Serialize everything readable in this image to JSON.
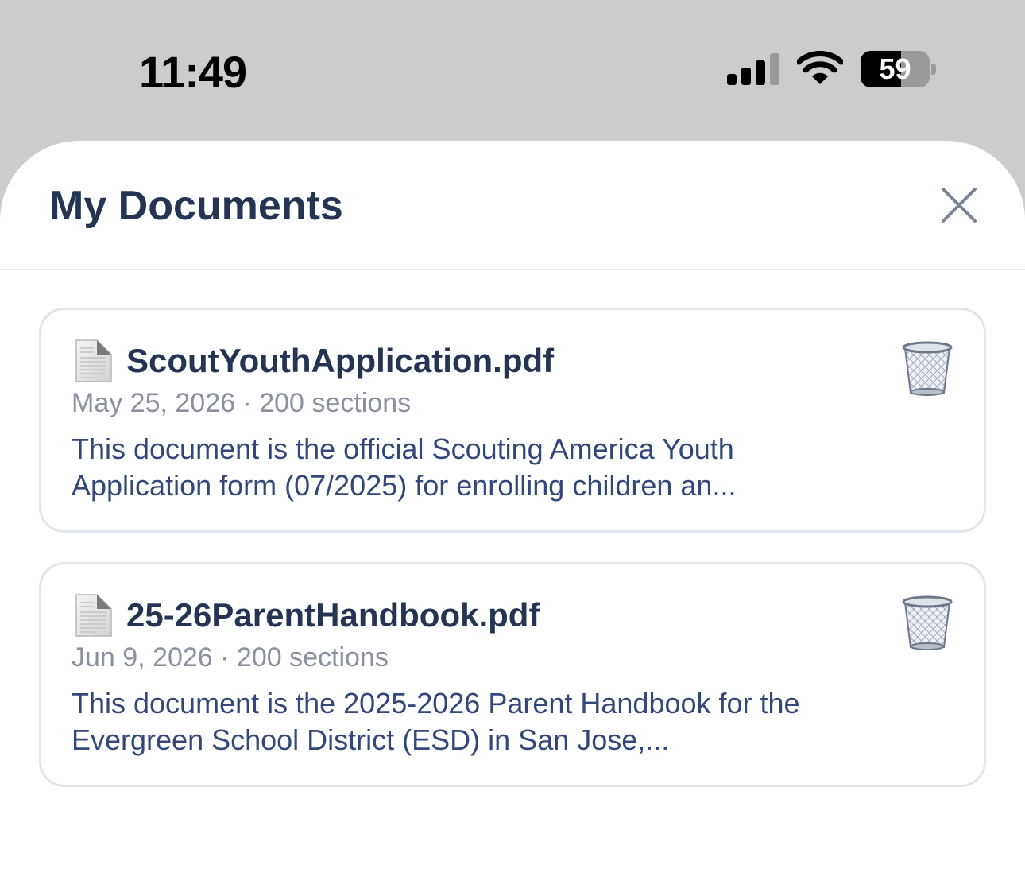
{
  "status_bar": {
    "time": "11:49",
    "battery": "59",
    "battery_level": 0.59
  },
  "sheet": {
    "title": "My Documents",
    "close_icon": "close-icon"
  },
  "documents": [
    {
      "title": "ScoutYouthApplication.pdf",
      "meta": "May 25, 2026 · 200 sections",
      "summary": "This document is the official Scouting America Youth Application form (07/2025) for enrolling children an...",
      "icon": "document-icon",
      "action_icon": "trash-icon"
    },
    {
      "title": "25-26ParentHandbook.pdf",
      "meta": "Jun 9, 2026 · 200 sections",
      "summary": "This document is the 2025-2026 Parent Handbook for the Evergreen School District (ESD) in San Jose,...",
      "icon": "document-icon",
      "action_icon": "trash-icon"
    }
  ],
  "colors": {
    "title": "#243452",
    "summary": "#34477a",
    "meta": "#8a919c",
    "card_border": "#e3e6ec",
    "status_bg": "#cccccc"
  }
}
